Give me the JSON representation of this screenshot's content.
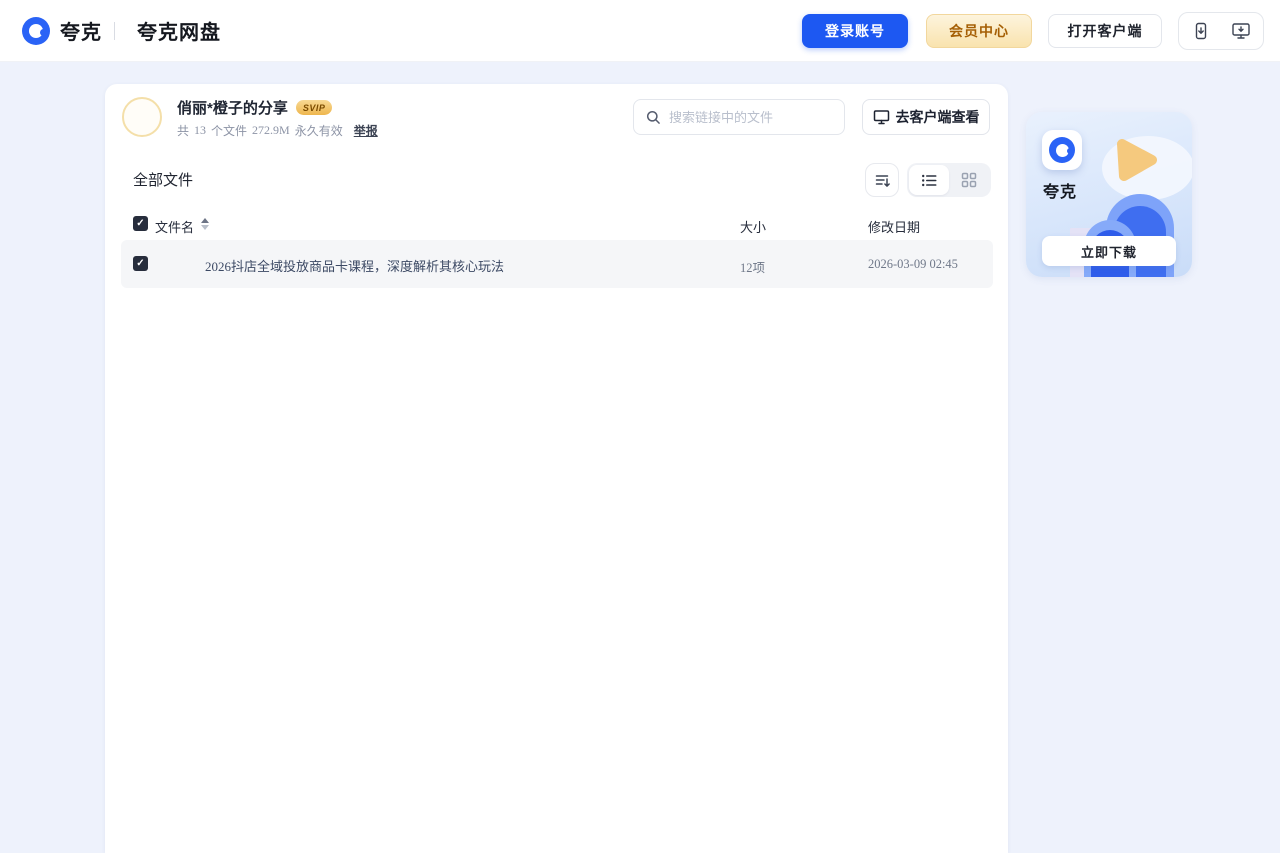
{
  "header": {
    "brand_primary": "夸克",
    "brand_secondary": "夸克网盘",
    "login_button": "登录账号",
    "member_button": "会员中心",
    "open_client_button": "打开客户端"
  },
  "share_info": {
    "title": "俏丽*橙子的分享",
    "vip_badge": "SVIP",
    "count_label": "共",
    "count_value": "13",
    "count_suffix": "个文件",
    "total_size": "272.9M",
    "validity": "永久有效",
    "report_link": "举报"
  },
  "toolbar": {
    "search_placeholder": "搜索链接中的文件",
    "client_view_button": "去客户端查看",
    "section_title": "全部文件"
  },
  "file_table": {
    "columns": {
      "name": "文件名",
      "size": "大小",
      "date": "修改日期"
    },
    "rows": [
      {
        "name": "2026抖店全域投放商品卡课程，深度解析其核心玩法",
        "size": "12项",
        "date": "2026-03-09 02:45",
        "selected": true
      }
    ]
  },
  "promo_card": {
    "app_name": "夸克",
    "download_button": "立即下载"
  },
  "icons": {
    "quark-logo-icon": "blue circle with white core",
    "search-icon": "magnifier",
    "monitor-icon": "desktop display",
    "phone-download-icon": "mobile app download",
    "desktop-download-icon": "desktop client download",
    "sort-icon": "sort lines with down arrow",
    "list-view-icon": "list layout",
    "grid-view-icon": "grid layout",
    "checkbox-check": "✓",
    "column-sort-carets": "up/down triangles",
    "play-triangle-decoration": "gold play button",
    "arch-decoration": "blue arches"
  },
  "colors": {
    "accent_blue": "#1d58f2",
    "logo_blue": "#2a63f6",
    "vip_gold_text": "#a55f05",
    "vip_gold_bg": "#f9e3ae",
    "svip_badge_bg": "#eeb64e",
    "page_background": "#eef2fc",
    "selected_row_bg": "#f5f6f8",
    "muted_text": "#8d94a6",
    "dark_text": "#1f2532"
  }
}
